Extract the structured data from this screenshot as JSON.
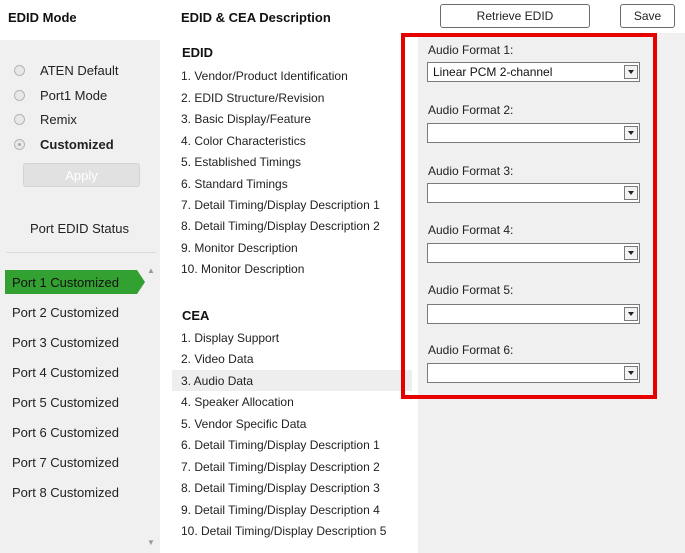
{
  "header": {
    "edid_mode_title": "EDID Mode",
    "edid_cea_title": "EDID & CEA Description",
    "retrieve_label": "Retrieve EDID",
    "save_label": "Save"
  },
  "modes": [
    {
      "label": "ATEN Default",
      "checked": false
    },
    {
      "label": "Port1 Mode",
      "checked": false
    },
    {
      "label": "Remix",
      "checked": false
    },
    {
      "label": "Customized",
      "checked": true
    }
  ],
  "apply_label": "Apply",
  "port_status_title": "Port EDID Status",
  "ports": [
    "Port 1  Customized",
    "Port 2  Customized",
    "Port 3  Customized",
    "Port 4  Customized",
    "Port 5  Customized",
    "Port 6  Customized",
    "Port 7  Customized",
    "Port 8  Customized"
  ],
  "edid": {
    "title": "EDID",
    "items": [
      "1.  Vendor/Product Identification",
      "2.  EDID Structure/Revision",
      "3.  Basic Display/Feature",
      "4.  Color Characteristics",
      "5.  Established Timings",
      "6.  Standard Timings",
      "7.  Detail Timing/Display Description 1",
      "8.  Detail Timing/Display Description 2",
      "9.  Monitor Description",
      "10.  Monitor Description"
    ]
  },
  "cea": {
    "title": "CEA",
    "items": [
      "1.  Display Support",
      "2.  Video Data",
      "3.  Audio Data",
      "4.  Speaker Allocation",
      "5.  Vendor Specific Data",
      "6.  Detail Timing/Display Description 1",
      "7.  Detail Timing/Display Description 2",
      "8.  Detail Timing/Display Description 3",
      "9.  Detail Timing/Display Description 4",
      "10.  Detail Timing/Display Description 5"
    ]
  },
  "audio_formats": [
    {
      "label": "Audio Format 1:",
      "value": "Linear PCM 2-channel"
    },
    {
      "label": "Audio Format 2:",
      "value": ""
    },
    {
      "label": "Audio Format 3:",
      "value": ""
    },
    {
      "label": "Audio Format 4:",
      "value": ""
    },
    {
      "label": "Audio Format 5:",
      "value": ""
    },
    {
      "label": "Audio Format 6:",
      "value": ""
    }
  ],
  "colors": {
    "active_port": "#33a032",
    "highlight_box": "#e60000"
  }
}
